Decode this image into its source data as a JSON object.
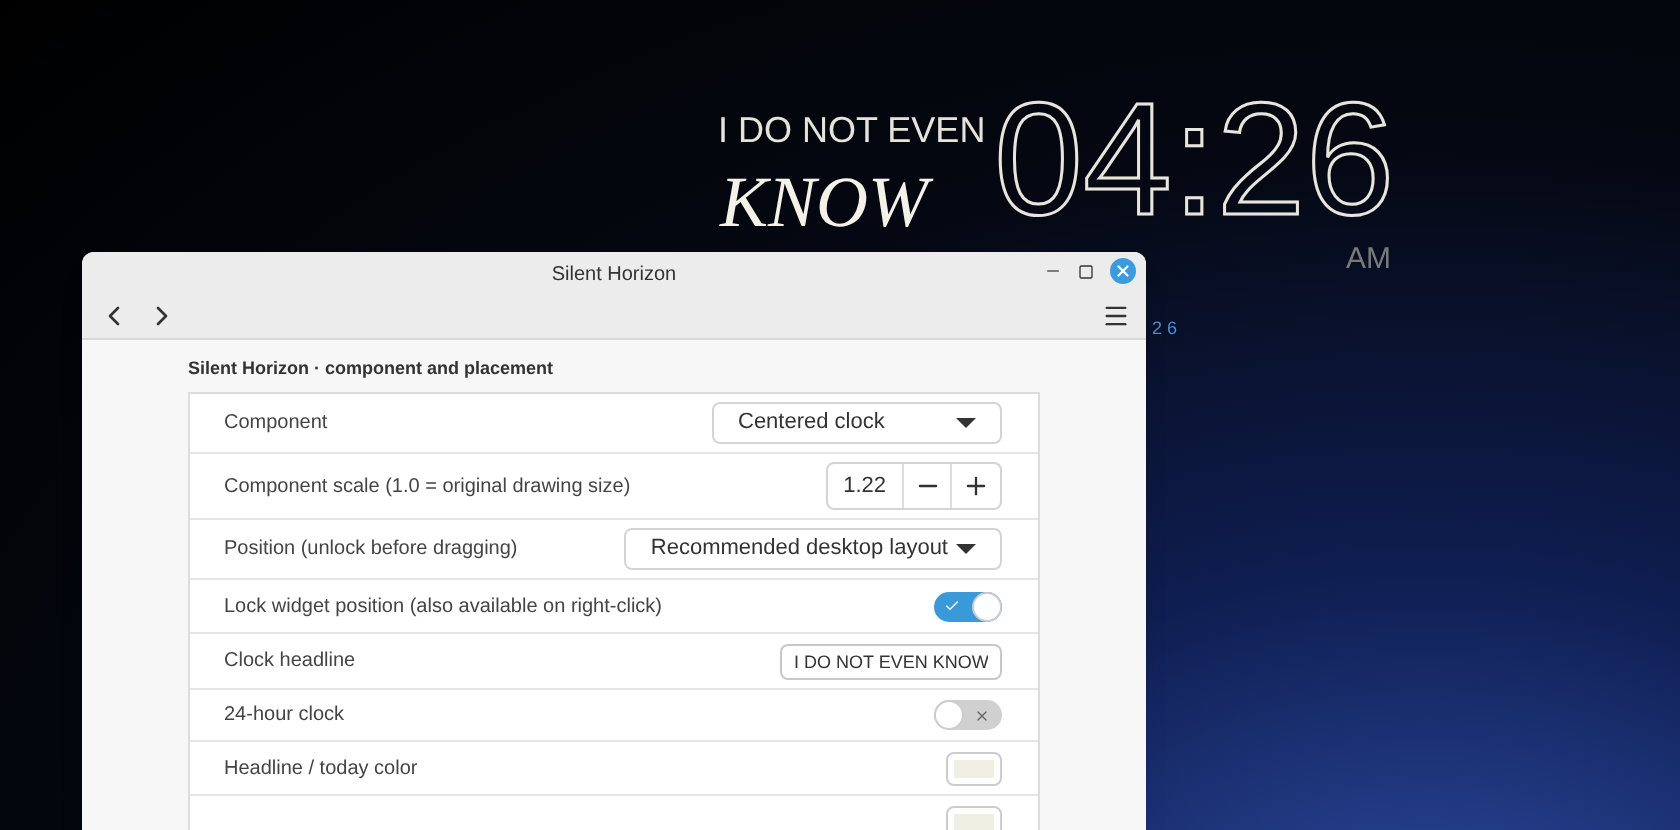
{
  "desklet": {
    "headline": "I DO NOT EVEN",
    "headline_word": "KNOW",
    "time": "04:26",
    "meridiem": "AM",
    "behind_text": "2 6"
  },
  "window": {
    "title": "Silent Horizon",
    "section_title": "Silent Horizon · component and placement",
    "rows": [
      {
        "kind": "dropdown",
        "label": "Component",
        "value": "Centered clock"
      },
      {
        "kind": "spin",
        "label": "Component scale (1.0 = original drawing size)",
        "value": "1.22"
      },
      {
        "kind": "dropdown",
        "label": "Position (unlock before dragging)",
        "value": "Recommended desktop layout"
      },
      {
        "kind": "switch",
        "label": "Lock widget position (also available on right-click)",
        "on": true
      },
      {
        "kind": "entry",
        "label": "Clock headline",
        "value": "I DO NOT EVEN KNOW"
      },
      {
        "kind": "switch",
        "label": "24-hour clock",
        "on": false
      },
      {
        "kind": "color",
        "label": "Headline / today color",
        "color": "#f0efe4"
      },
      {
        "kind": "color",
        "color": "#f0efe4"
      }
    ]
  }
}
